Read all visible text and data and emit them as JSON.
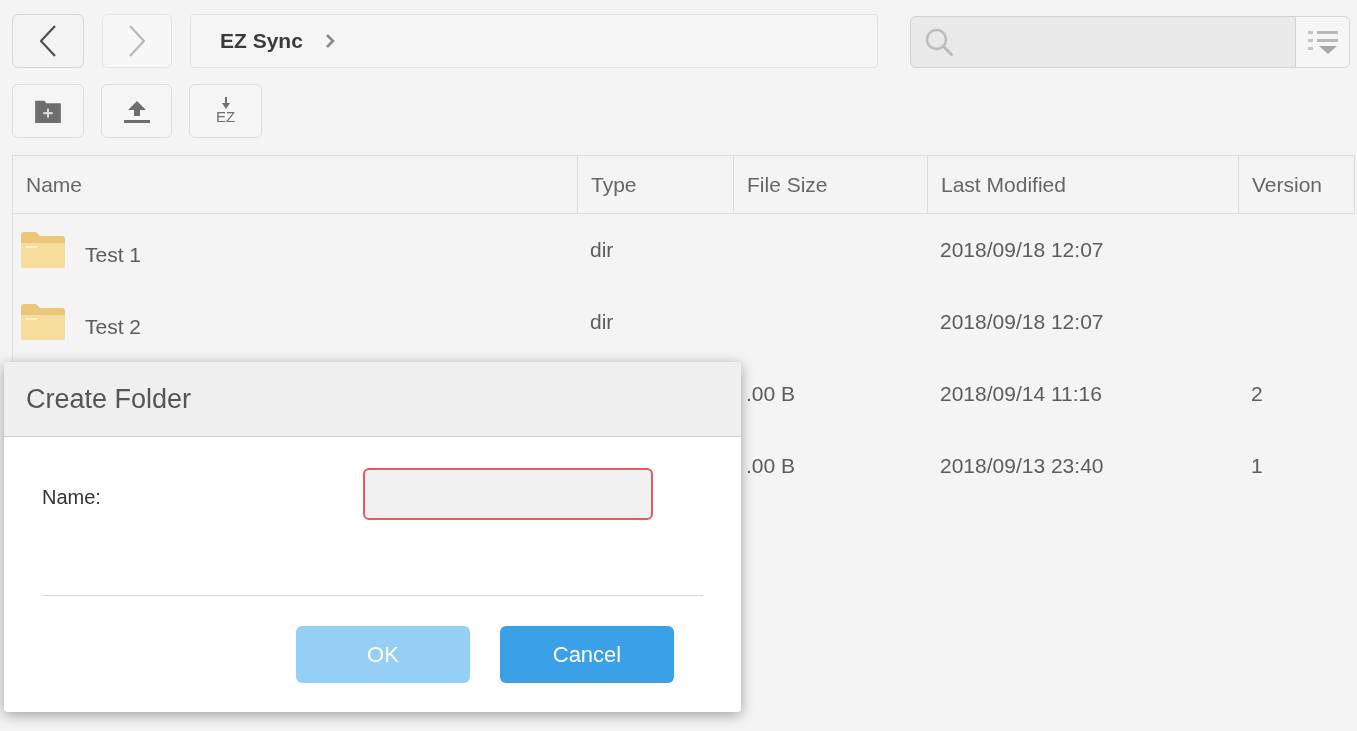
{
  "nav": {
    "buttons": [
      {
        "kind": "back",
        "disabled": false
      },
      {
        "kind": "forward",
        "disabled": true
      }
    ],
    "breadcrumb": [
      {
        "label": "EZ Sync"
      }
    ]
  },
  "toolbar": [
    {
      "kind": "folder"
    },
    {
      "kind": "upload"
    },
    {
      "kind": "labeled",
      "label": "EZ"
    }
  ],
  "table": {
    "columns": [
      "Name",
      "Type",
      "File Size",
      "Last Modified",
      "Version"
    ],
    "rows": [
      {
        "name": "Test 1",
        "type": "dir",
        "last_modified": "2018/09/18 12:07"
      },
      {
        "name": "Test 2",
        "type": "dir",
        "last_modified": "2018/09/18 12:07"
      },
      {
        "file_size": ".00 B",
        "last_modified": "2018/09/14 11:16",
        "version": "2"
      },
      {
        "file_size": ".00 B",
        "last_modified": "2018/09/13 23:40",
        "version": "1"
      }
    ]
  },
  "dialog": {
    "title": "Create Folder",
    "field": {
      "label": "Name:",
      "invalid": true
    },
    "buttons": [
      {
        "label": "OK",
        "disabled": true
      },
      {
        "label": "Cancel",
        "disabled": false
      }
    ]
  }
}
